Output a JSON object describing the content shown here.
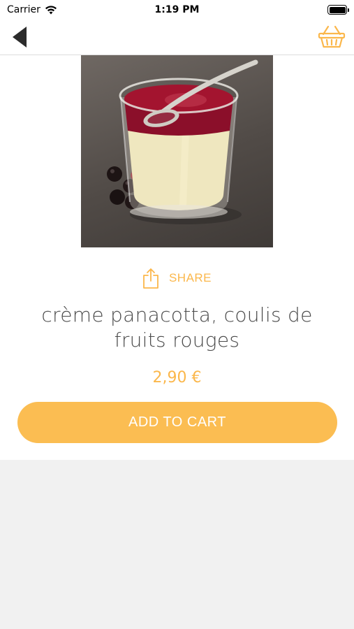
{
  "status_bar": {
    "carrier": "Carrier",
    "time": "1:19 PM",
    "wifi_icon": "wifi-icon",
    "battery_icon": "battery-icon"
  },
  "nav": {
    "back_icon": "back-arrow-icon",
    "cart_icon": "basket-icon"
  },
  "product": {
    "image_description": "panna-cotta-in-glass",
    "share_label": "SHARE",
    "share_icon": "share-icon",
    "title": "crème panacotta, coulis de fruits rouges",
    "price": "2,90 €",
    "add_to_cart_label": "ADD TO CART"
  },
  "colors": {
    "accent": "#fbb74b",
    "button": "#fbbd52",
    "title_text": "#4a4a4a",
    "background": "#f1f1f1"
  }
}
